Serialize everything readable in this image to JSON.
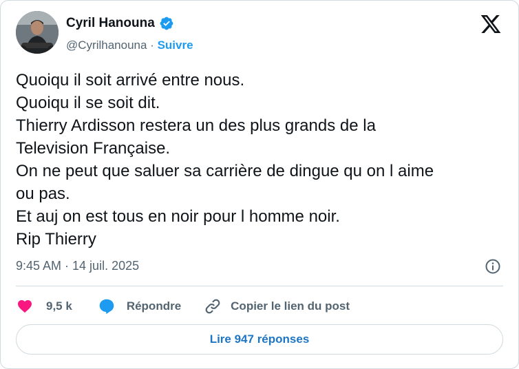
{
  "author": {
    "name": "Cyril Hanouna",
    "handle": "@Cyrilhanouna",
    "separator": "·",
    "follow_label": "Suivre",
    "verified_icon": "verified-badge-icon"
  },
  "tweet": {
    "lines": [
      "Quoiqu il soit arrivé entre nous.",
      "Quoiqu il se soit dit.",
      "Thierry Ardisson restera un des plus grands de la",
      "Television Française.",
      "On ne peut que saluer sa carrière de dingue qu on l aime",
      "ou pas.",
      "Et auj on est tous en noir pour l homme noir.",
      "Rip Thierry"
    ],
    "timestamp": "9:45 AM · 14 juil. 2025"
  },
  "actions": {
    "likes": "9,5 k",
    "reply_label": "Répondre",
    "copy_label": "Copier le lien du post"
  },
  "read_replies_label": "Lire 947 réponses",
  "colors": {
    "accent": "#1d9bf0",
    "like": "#f91880",
    "muted": "#536471",
    "text": "#0f1419",
    "border": "#cfd9de"
  }
}
